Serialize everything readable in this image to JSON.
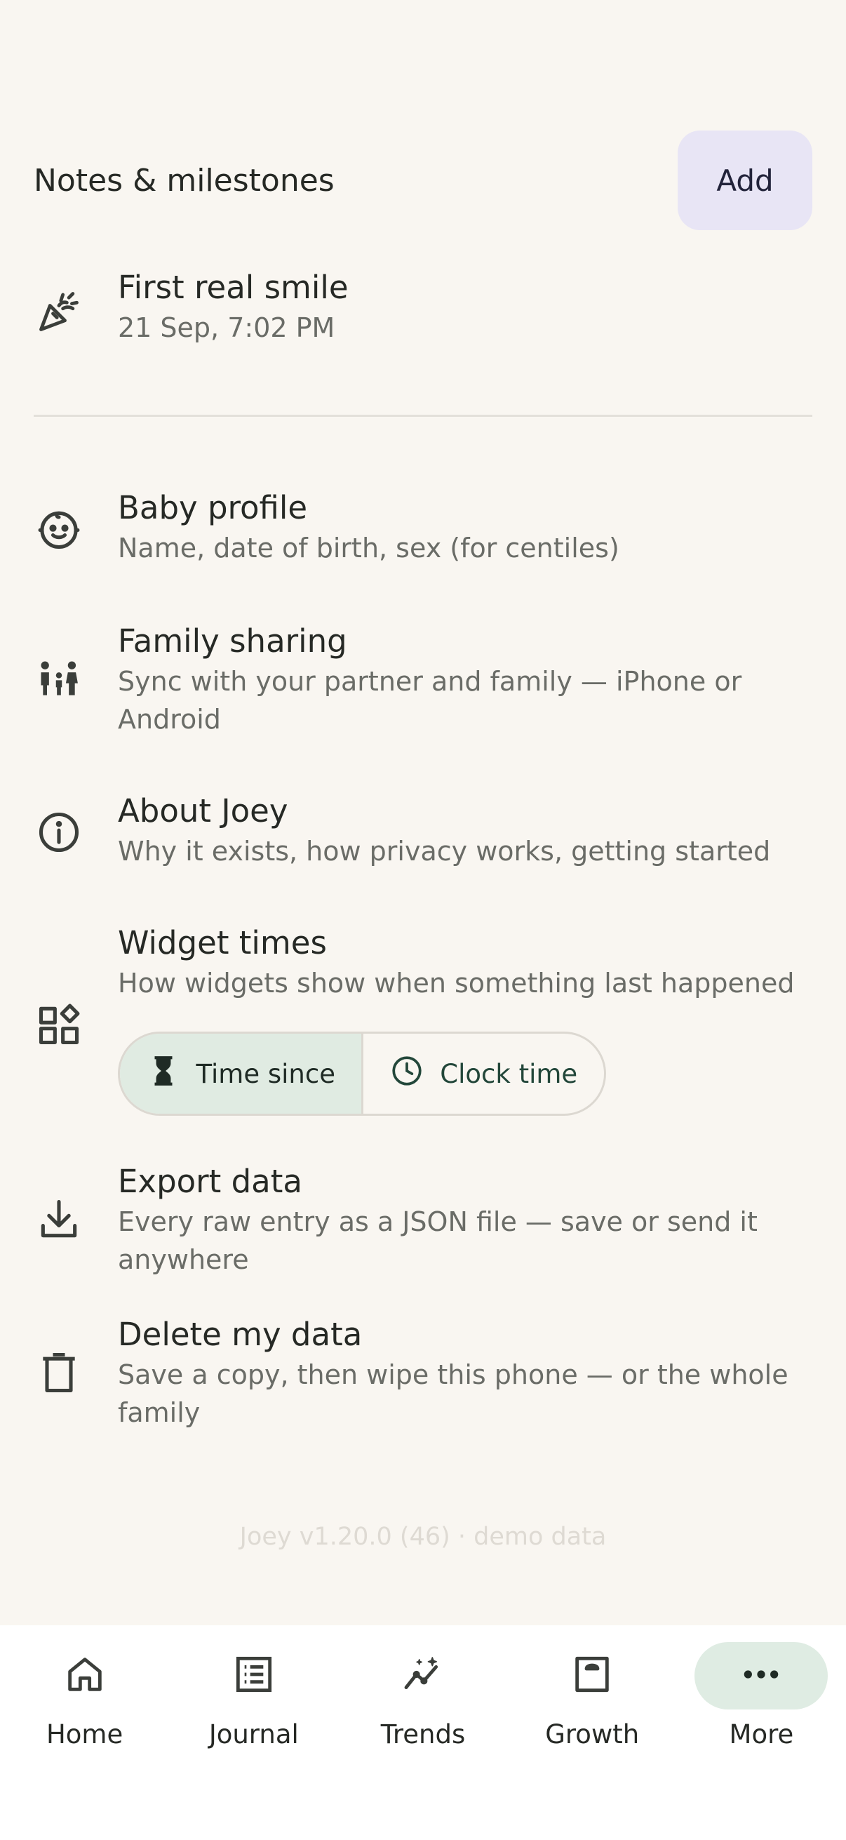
{
  "notes": {
    "title": "Notes & milestones",
    "add_label": "Add",
    "items": [
      {
        "title": "First real smile",
        "subtitle": "21 Sep, 7:02 PM",
        "icon": "party-popper-icon"
      }
    ]
  },
  "settings": [
    {
      "key": "baby_profile",
      "title": "Baby profile",
      "subtitle": "Name, date of birth, sex (for centiles)",
      "icon": "baby-face-icon"
    },
    {
      "key": "family_sharing",
      "title": "Family sharing",
      "subtitle": "Sync with your partner and family — iPhone or Android",
      "icon": "family-icon"
    },
    {
      "key": "about",
      "title": "About Joey",
      "subtitle": "Why it exists, how privacy works, getting started",
      "icon": "info-icon"
    },
    {
      "key": "widget_times",
      "title": "Widget times",
      "subtitle": "How widgets show when something last happened",
      "icon": "widgets-icon"
    },
    {
      "key": "export",
      "title": "Export data",
      "subtitle": "Every raw entry as a JSON file — save or send it anywhere",
      "icon": "download-icon"
    },
    {
      "key": "delete",
      "title": "Delete my data",
      "subtitle": "Save a copy, then wipe this phone — or the whole family",
      "icon": "trash-icon"
    }
  ],
  "widget_times_options": [
    {
      "label": "Time since",
      "icon": "hourglass-icon",
      "selected": true
    },
    {
      "label": "Clock time",
      "icon": "clock-icon",
      "selected": false
    }
  ],
  "version_text": "Joey v1.20.0 (46) · demo data",
  "bottom_nav": [
    {
      "label": "Home",
      "icon": "home-icon",
      "active": false
    },
    {
      "label": "Journal",
      "icon": "journal-icon",
      "active": false
    },
    {
      "label": "Trends",
      "icon": "trends-icon",
      "active": false
    },
    {
      "label": "Growth",
      "icon": "growth-icon",
      "active": false
    },
    {
      "label": "More",
      "icon": "more-icon",
      "active": true
    }
  ],
  "colors": {
    "background": "#f9f6f1",
    "add_button_bg": "#e8e5f5",
    "selected_segment": "#e0ebe2",
    "active_nav_pill": "#dfece3",
    "accent_green": "#23473a"
  }
}
